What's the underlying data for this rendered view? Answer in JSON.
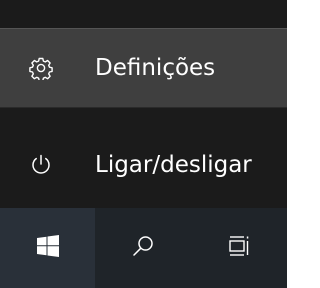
{
  "start_menu": {
    "items": [
      {
        "label": "Definições",
        "icon": "gear-icon"
      },
      {
        "label": "Ligar/desligar",
        "icon": "power-icon"
      }
    ]
  },
  "taskbar": {
    "buttons": [
      {
        "icon": "windows-logo-icon"
      },
      {
        "icon": "search-icon"
      },
      {
        "icon": "task-view-icon"
      }
    ]
  },
  "colors": {
    "menu_background": "#1b1b1b",
    "hover_background": "#3f3f3f",
    "taskbar_background": "#1f2429",
    "start_button_background": "#293039",
    "foreground": "#ffffff"
  }
}
